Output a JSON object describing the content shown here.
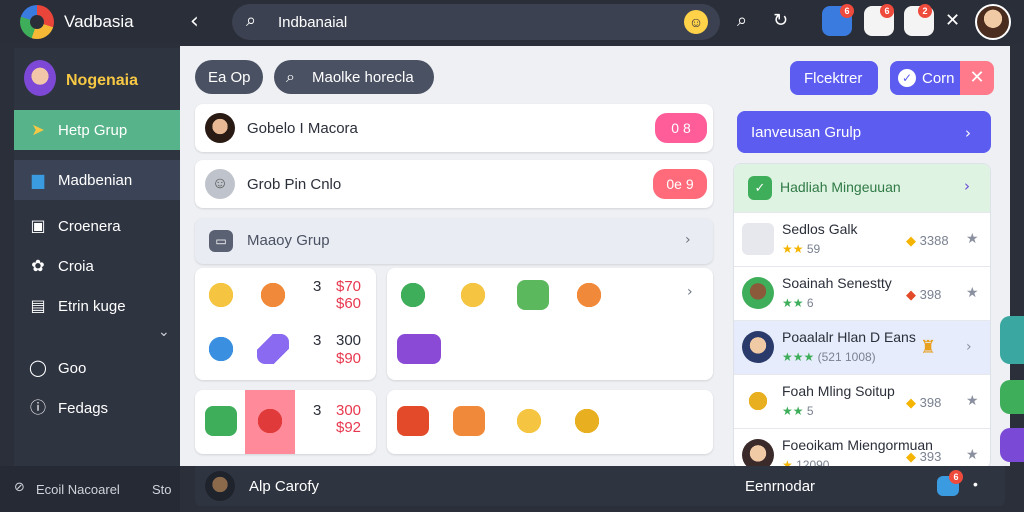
{
  "app": {
    "title": "Vadbasia"
  },
  "search": {
    "value": "Indbanaial"
  },
  "sidebar": {
    "user": "Nogenaia",
    "items": [
      {
        "label": "Hetp Grup"
      },
      {
        "label": "Madbenian"
      },
      {
        "label": "Croenera"
      },
      {
        "label": "Croia"
      },
      {
        "label": "Etrin kuge"
      },
      {
        "label": "Goo"
      },
      {
        "label": "Fedags"
      }
    ]
  },
  "footer": {
    "left": "Ecoil Nacoarel",
    "right": "Sto"
  },
  "notifications": {
    "a": "6",
    "b": "6",
    "c": "2"
  },
  "main": {
    "pill1": "Ea Op",
    "pill2": "Maolke horecla",
    "btn_primary": "Flcektrer",
    "btn_secondary": "Corn",
    "rows": [
      {
        "label": "Gobelo I Macora",
        "badge": "0 8"
      },
      {
        "label": "Grob Pin Cnlo",
        "badge": "0e 9"
      }
    ],
    "section_title": "Maaoy Grup",
    "gift_rows": [
      {
        "count": "3",
        "price_top": "$70",
        "price_bottom": "$60"
      },
      {
        "count": "3",
        "price_top": "300",
        "price_bottom": "$90"
      },
      {
        "count": "3",
        "price_top": "300",
        "price_bottom": "$92"
      }
    ],
    "bottom_label": "Alp Carofy",
    "bottom_right": "Eenrnodar"
  },
  "right": {
    "header": "Ianveusan Grulp",
    "featured": "Hadliah Mingeuuan",
    "rows": [
      {
        "title": "Sedlos Galk",
        "sub": "59",
        "val": "3388"
      },
      {
        "title": "Soainah Senestty",
        "sub": "6",
        "val": "398"
      },
      {
        "title": "Poaalalr Hlan D Eans",
        "sub": "(521 1008)",
        "val": ""
      },
      {
        "title": "Foah Mling Soitup",
        "sub": "5",
        "val": "398"
      },
      {
        "title": "Foeoikam Miengormuan",
        "sub": "12090",
        "val": "393"
      }
    ]
  },
  "colors": {
    "accent": "#5c5cf0",
    "active": "#57b48a",
    "danger": "#e8384f",
    "badge": "#ef4b3d"
  }
}
